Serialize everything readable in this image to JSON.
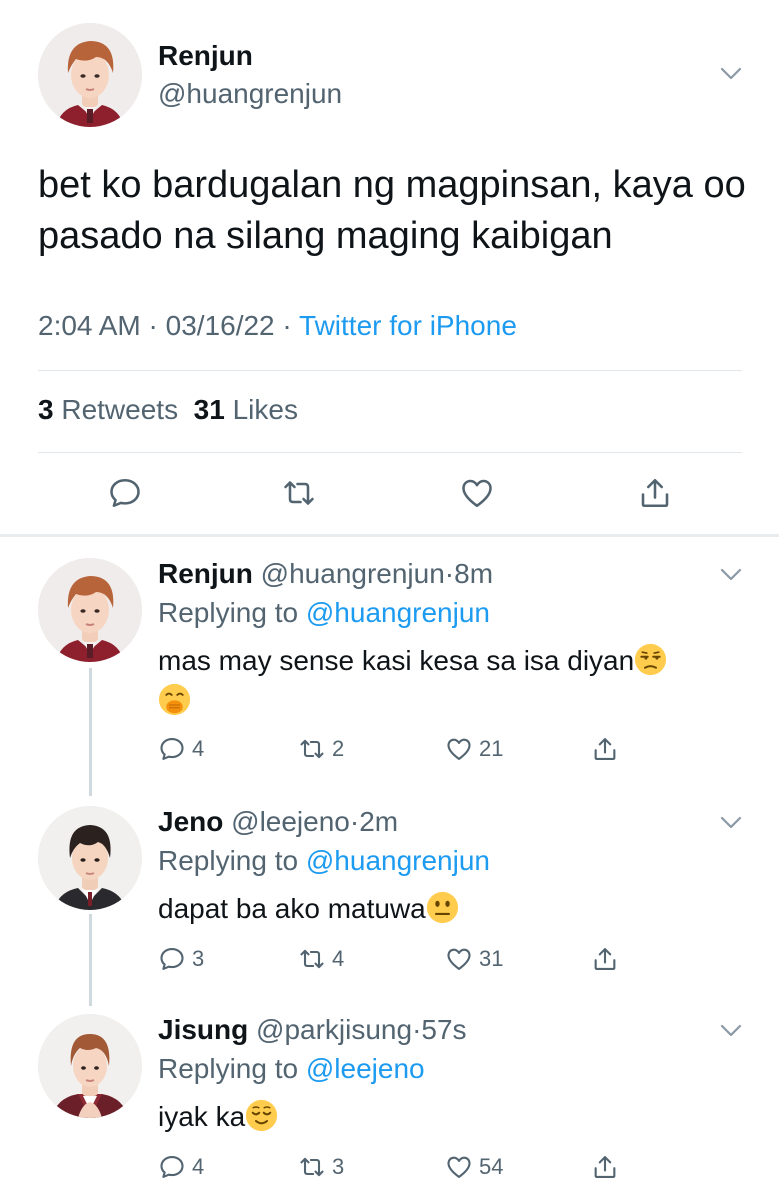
{
  "main_tweet": {
    "name": "Renjun",
    "handle": "@huangrenjun",
    "text": "bet ko bardugalan ng magpinsan, kaya oo pasado na silang maging kaibigan",
    "time": "2:04 AM",
    "date": "03/16/22",
    "separator": "·",
    "source": "Twitter for iPhone",
    "retweets_count": "3",
    "retweets_label": "Retweets",
    "likes_count": "31",
    "likes_label": "Likes"
  },
  "icons": {
    "reply": "reply-icon",
    "retweet": "retweet-icon",
    "like": "heart-icon",
    "share": "share-icon",
    "more": "chevron-down-icon"
  },
  "colors": {
    "link": "#1d9bf0",
    "secondary_text": "#536471",
    "divider": "#e1e6ea",
    "thread_line": "#cfd9de"
  },
  "replies": [
    {
      "name": "Renjun",
      "handle": "@huangrenjun",
      "dot": "·",
      "time": "8m",
      "replying_label": "Replying to",
      "replying_to": "@huangrenjun",
      "text": "mas may sense kasi kesa sa isa diyan",
      "emojis": [
        "unamused-face",
        "face-with-hand-over-mouth"
      ],
      "reply_count": "4",
      "retweet_count": "2",
      "like_count": "21"
    },
    {
      "name": "Jeno",
      "handle": "@leejeno",
      "dot": "·",
      "time": "2m",
      "replying_label": "Replying to",
      "replying_to": "@huangrenjun",
      "text": "dapat ba ako matuwa",
      "emojis": [
        "neutral-face"
      ],
      "reply_count": "3",
      "retweet_count": "4",
      "like_count": "31"
    },
    {
      "name": "Jisung",
      "handle": "@parkjisung",
      "dot": "·",
      "time": "57s",
      "replying_label": "Replying to",
      "replying_to": "@leejeno",
      "text": "iyak ka",
      "emojis": [
        "relieved-face"
      ],
      "reply_count": "4",
      "retweet_count": "3",
      "like_count": "54"
    }
  ]
}
